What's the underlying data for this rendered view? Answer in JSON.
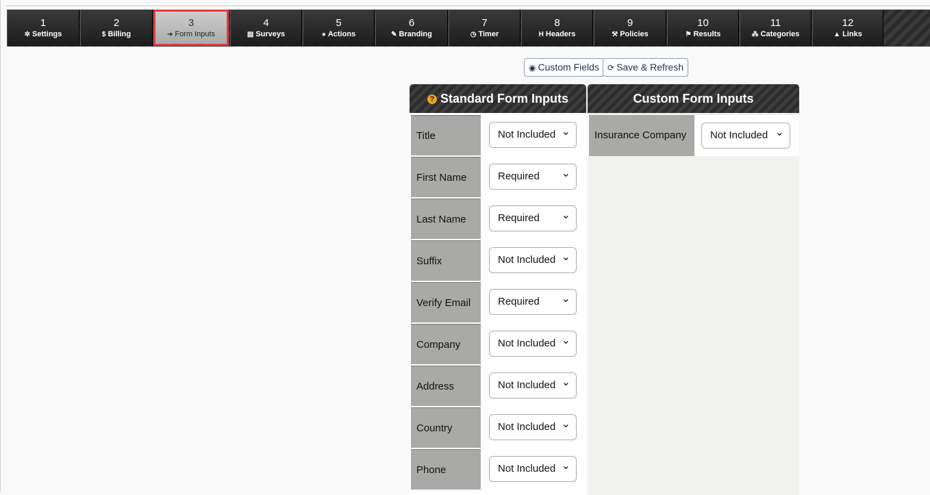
{
  "tabs": [
    {
      "num": "1",
      "icon": "✲",
      "label": "Settings"
    },
    {
      "num": "2",
      "icon": "$",
      "label": "Billing"
    },
    {
      "num": "3",
      "icon": "➔",
      "label": "Form Inputs"
    },
    {
      "num": "4",
      "icon": "▤",
      "label": "Surveys"
    },
    {
      "num": "5",
      "icon": "●",
      "label": "Actions"
    },
    {
      "num": "6",
      "icon": "✎",
      "label": "Branding"
    },
    {
      "num": "7",
      "icon": "◷",
      "label": "Timer"
    },
    {
      "num": "8",
      "icon": "H",
      "label": "Headers"
    },
    {
      "num": "9",
      "icon": "⚒",
      "label": "Policies"
    },
    {
      "num": "10",
      "icon": "⚑",
      "label": "Results"
    },
    {
      "num": "11",
      "icon": "⁂",
      "label": "Categories"
    },
    {
      "num": "12",
      "icon": "▲",
      "label": "Links"
    }
  ],
  "active_tab": "3",
  "toolbar": {
    "custom_fields_label": "Custom Fields",
    "save_refresh_label": "Save & Refresh"
  },
  "standard": {
    "title": "Standard Form Inputs",
    "rows": [
      {
        "label": "Title",
        "value": "Not Included"
      },
      {
        "label": "First Name",
        "value": "Required"
      },
      {
        "label": "Last Name",
        "value": "Required"
      },
      {
        "label": "Suffix",
        "value": "Not Included"
      },
      {
        "label": "Verify Email",
        "value": "Required"
      },
      {
        "label": "Company",
        "value": "Not Included"
      },
      {
        "label": "Address",
        "value": "Not Included"
      },
      {
        "label": "Country",
        "value": "Not Included"
      },
      {
        "label": "Phone",
        "value": "Not Included"
      }
    ]
  },
  "custom": {
    "title": "Custom Form Inputs",
    "rows": [
      {
        "label": "Insurance Company",
        "value": "Not Included"
      }
    ]
  },
  "colors": {
    "active_outline": "#e33b3b",
    "help_icon": "#e8a21a",
    "button_text": "#1d2f55"
  }
}
